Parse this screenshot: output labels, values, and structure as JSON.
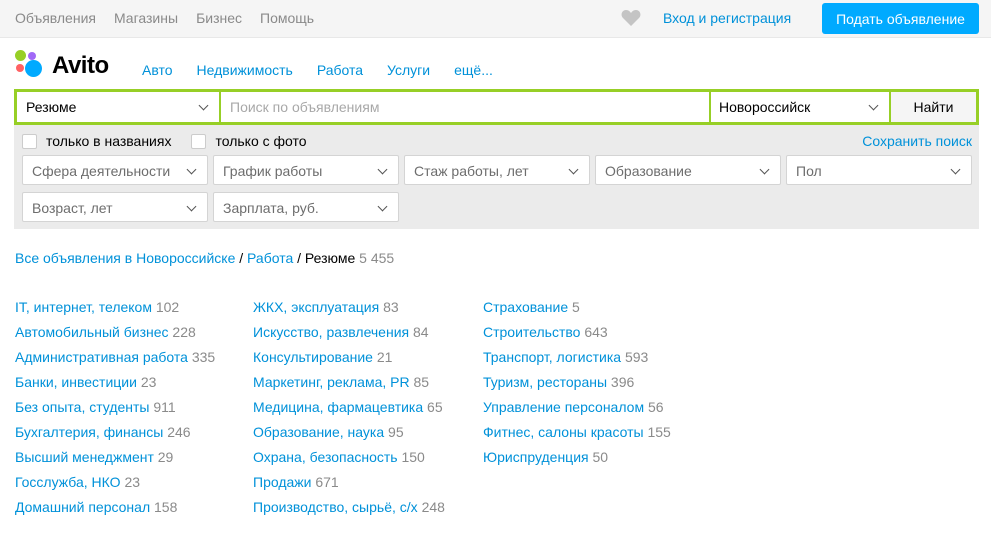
{
  "topbar": {
    "nav": [
      "Объявления",
      "Магазины",
      "Бизнес",
      "Помощь"
    ],
    "login": "Вход и регистрация",
    "post_button": "Подать объявление"
  },
  "logo": {
    "text": "Avito"
  },
  "main_nav": [
    "Авто",
    "Недвижимость",
    "Работа",
    "Услуги",
    "ещё..."
  ],
  "search": {
    "category": "Резюме",
    "placeholder": "Поиск по объявлениям",
    "city": "Новороссийск",
    "find_button": "Найти",
    "only_titles": "только в названиях",
    "only_photo": "только с фото",
    "save_search": "Сохранить поиск"
  },
  "filters": [
    "Сфера деятельности",
    "График работы",
    "Стаж работы, лет",
    "Образование",
    "Пол",
    "Возраст, лет",
    "Зарплата, руб."
  ],
  "breadcrumb": {
    "all": "Все объявления в Новороссийске",
    "work": "Работа",
    "current": "Резюме",
    "count": "5 455"
  },
  "categories": [
    [
      {
        "name": "IT, интернет, телеком",
        "count": "102"
      },
      {
        "name": "Автомобильный бизнес",
        "count": "228"
      },
      {
        "name": "Административная работа",
        "count": "335"
      },
      {
        "name": "Банки, инвестиции",
        "count": "23"
      },
      {
        "name": "Без опыта, студенты",
        "count": "911"
      },
      {
        "name": "Бухгалтерия, финансы",
        "count": "246"
      },
      {
        "name": "Высший менеджмент",
        "count": "29"
      },
      {
        "name": "Госслужба, НКО",
        "count": "23"
      },
      {
        "name": "Домашний персонал",
        "count": "158"
      }
    ],
    [
      {
        "name": "ЖКХ, эксплуатация",
        "count": "83"
      },
      {
        "name": "Искусство, развлечения",
        "count": "84"
      },
      {
        "name": "Консультирование",
        "count": "21"
      },
      {
        "name": "Маркетинг, реклама, PR",
        "count": "85"
      },
      {
        "name": "Медицина, фармацевтика",
        "count": "65"
      },
      {
        "name": "Образование, наука",
        "count": "95"
      },
      {
        "name": "Охрана, безопасность",
        "count": "150"
      },
      {
        "name": "Продажи",
        "count": "671"
      },
      {
        "name": "Производство, сырьё, с/х",
        "count": "248"
      }
    ],
    [
      {
        "name": "Страхование",
        "count": "5"
      },
      {
        "name": "Строительство",
        "count": "643"
      },
      {
        "name": "Транспорт, логистика",
        "count": "593"
      },
      {
        "name": "Туризм, рестораны",
        "count": "396"
      },
      {
        "name": "Управление персоналом",
        "count": "56"
      },
      {
        "name": "Фитнес, салоны красоты",
        "count": "155"
      },
      {
        "name": "Юриспруденция",
        "count": "50"
      }
    ]
  ],
  "icons": {
    "favorites": "heart-icon",
    "dropdown": "chevron-down-icon"
  },
  "colors": {
    "link": "#0091d9",
    "accent": "#00aaff",
    "search_border": "#97cf26",
    "muted": "#8a8a8a"
  }
}
